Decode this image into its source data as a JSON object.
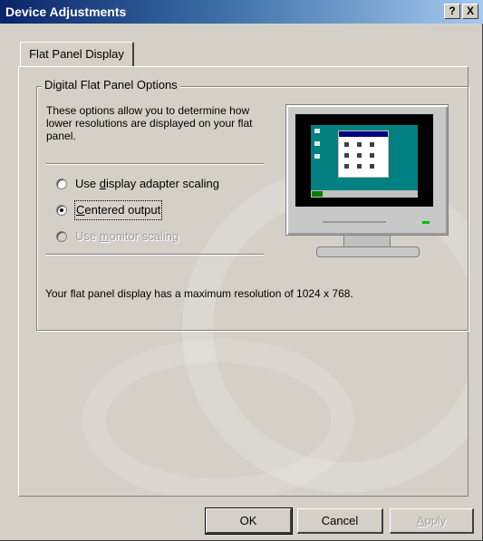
{
  "window": {
    "title": "Device Adjustments",
    "help_label": "?",
    "close_label": "X"
  },
  "tabs": [
    {
      "label": "Flat Panel Display",
      "active": true
    }
  ],
  "group": {
    "title": "Digital Flat Panel Options",
    "description": "These options allow you to determine how lower resolutions are displayed on your flat panel.",
    "options": [
      {
        "label_before": "Use ",
        "mnemonic": "d",
        "label_after": "isplay adapter scaling",
        "checked": false,
        "enabled": true
      },
      {
        "label_before": "",
        "mnemonic": "C",
        "label_after": "entered output",
        "checked": true,
        "enabled": true
      },
      {
        "label_before": "Use ",
        "mnemonic": "m",
        "label_after": "onitor scaling",
        "checked": false,
        "enabled": false
      }
    ],
    "max_resolution_text": "Your flat panel display has a maximum resolution of 1024 x 768."
  },
  "buttons": {
    "ok": "OK",
    "cancel": "Cancel",
    "apply_mnemonic": "A",
    "apply_rest": "pply"
  },
  "colors": {
    "title_bar_start": "#0a246a",
    "title_bar_end": "#a6caf0",
    "dialog_face": "#d4d0c8",
    "desktop_teal": "#008080"
  }
}
